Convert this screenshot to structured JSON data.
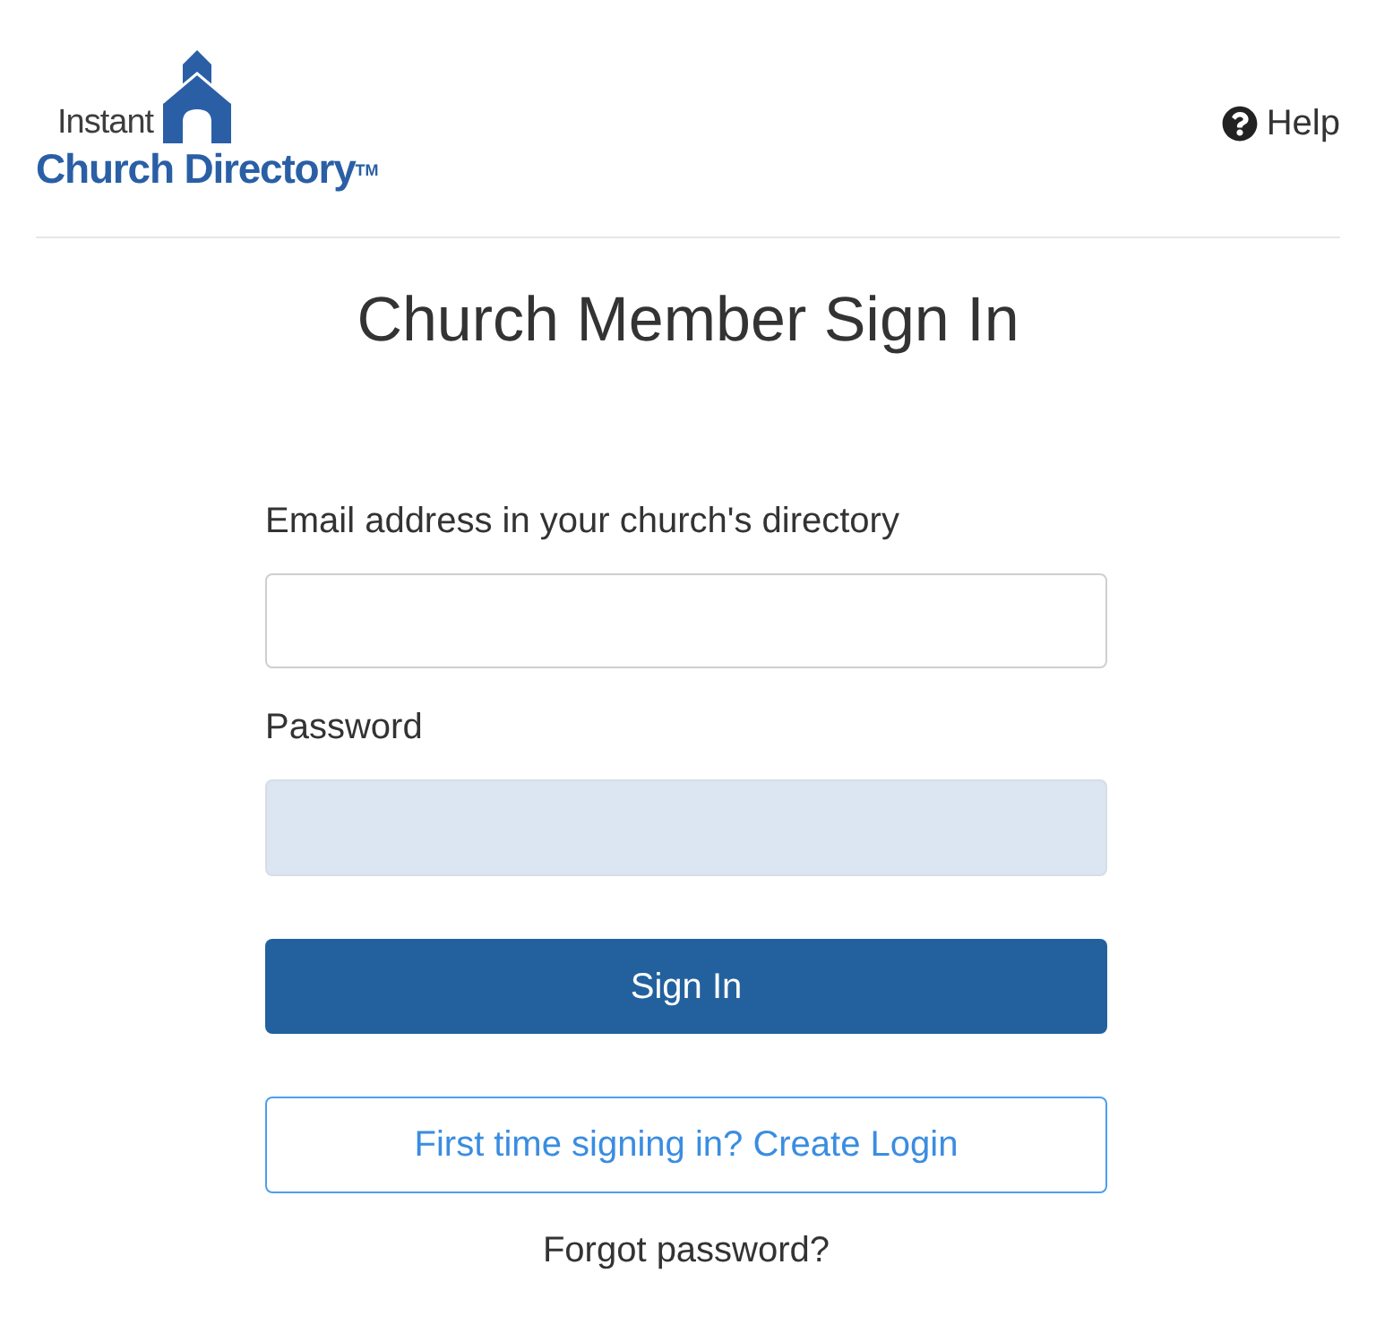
{
  "header": {
    "logo": {
      "line_1": "Instant",
      "line_2": "Church Directory$^{TM}$"
    },
    "help_link": {
      "label": "Help"
    }
  },
  "title": "Church Member Sign In",
  "form": {
    "fields": [
      {
        "label": "Email address in your church's directory",
        "autofilled": false
      },
      {
        "label": "Password",
        "autofilled": true
      }
    ],
    "sign_in_button": "Sign In",
    "create_login_button": "First time signing in? Create Login",
    "forgot_password_link": "Forgot password?"
  }
}
